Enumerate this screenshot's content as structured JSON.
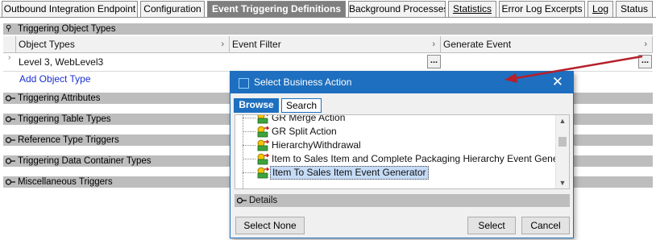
{
  "tabs": [
    {
      "label": "Outbound Integration Endpoint"
    },
    {
      "label": "Configuration"
    },
    {
      "label": "Event Triggering Definitions"
    },
    {
      "label": "Background Processes"
    },
    {
      "label": "Statistics"
    },
    {
      "label": "Error Log Excerpts"
    },
    {
      "label": "Log"
    },
    {
      "label": "Status"
    }
  ],
  "active_tab": "Event Triggering Definitions",
  "sections": {
    "object_types": "Triggering Object Types",
    "attributes": "Triggering Attributes",
    "table_types": "Triggering Table Types",
    "reference_types": "Reference Type Triggers",
    "data_container_types": "Triggering Data Container Types",
    "misc": "Miscellaneous Triggers"
  },
  "grid": {
    "columns": [
      "Object Types",
      "Event Filter",
      "Generate Event"
    ],
    "rows": [
      {
        "object_type": "Level 3, WebLevel3",
        "event_filter_button": "...",
        "generate_event_button": "..."
      }
    ],
    "add_link": "Add Object Type"
  },
  "dialog": {
    "title": "Select Business Action",
    "tabs": {
      "browse": "Browse",
      "search": "Search"
    },
    "tree_items": [
      {
        "label": "GR Merge Action",
        "selected": false
      },
      {
        "label": "GR Split Action",
        "selected": false
      },
      {
        "label": "HierarchyWithdrawal",
        "selected": false
      },
      {
        "label": "Item to Sales Item and Complete Packaging Hierarchy Event Generator",
        "selected": false
      },
      {
        "label": "Item To Sales Item Event Generator",
        "selected": true
      }
    ],
    "details_label": "Details",
    "buttons": {
      "select_none": "Select None",
      "select": "Select",
      "cancel": "Cancel"
    }
  },
  "colors": {
    "accent": "#1e6fbf",
    "section_bar": "#bdbdbd",
    "arrow": "#b5202a",
    "link": "#1a2fd1"
  }
}
